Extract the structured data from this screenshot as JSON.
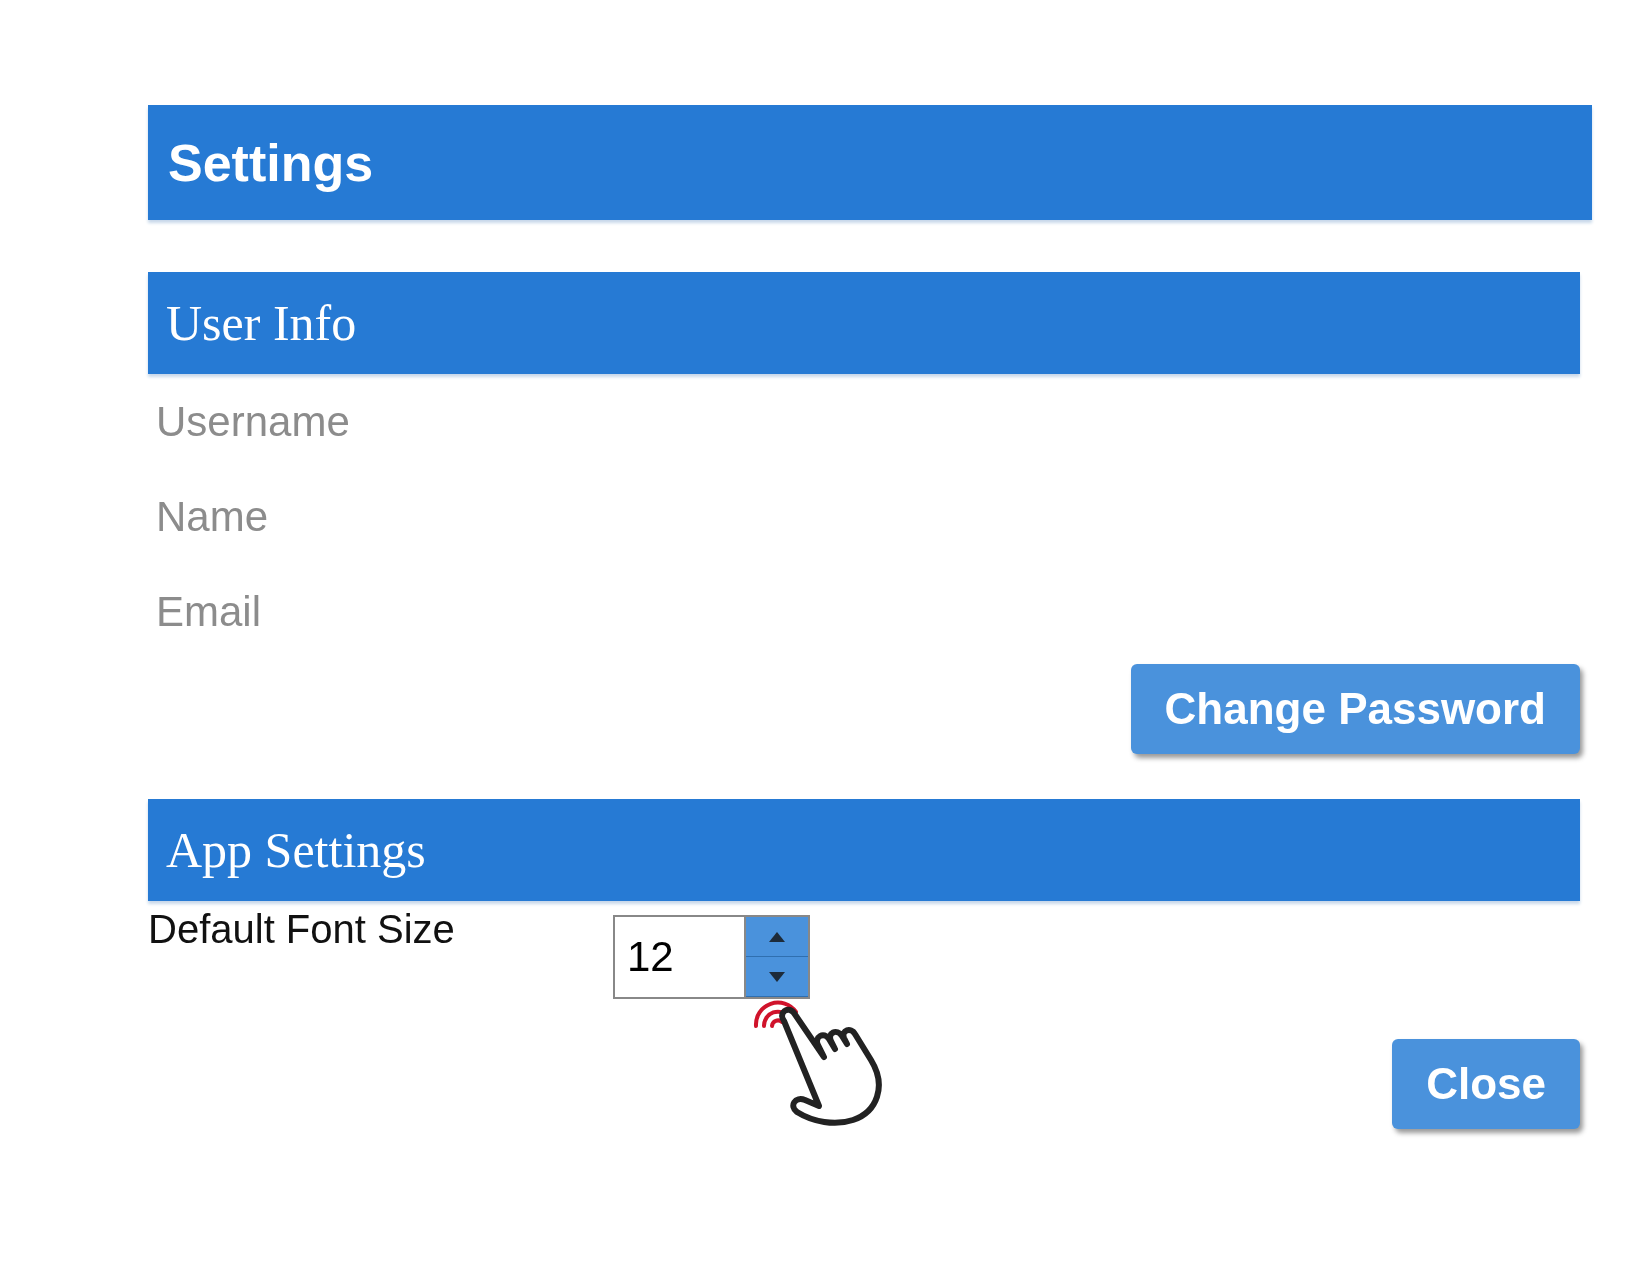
{
  "window": {
    "title": "Settings"
  },
  "user_info": {
    "title": "User Info",
    "fields": [
      {
        "placeholder": "Username"
      },
      {
        "placeholder": "Name"
      },
      {
        "placeholder": "Email"
      }
    ],
    "button": "Change Password"
  },
  "app_settings": {
    "title": "App Settings",
    "font_size": {
      "label": "Default Font Size",
      "value": "12"
    }
  },
  "buttons": [
    "Close"
  ]
}
